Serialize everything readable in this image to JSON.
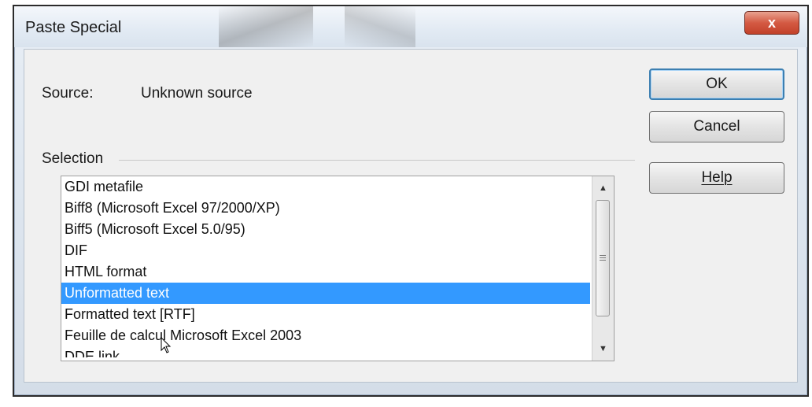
{
  "dialog": {
    "title": "Paste Special",
    "close_label": "x"
  },
  "source": {
    "label": "Source:",
    "value": "Unknown source"
  },
  "selection": {
    "label": "Selection",
    "items": [
      "GDI metafile",
      "Biff8 (Microsoft Excel 97/2000/XP)",
      "Biff5 (Microsoft Excel 5.0/95)",
      "DIF",
      "HTML format",
      "Unformatted text",
      "Formatted text [RTF]",
      "Feuille de calcul Microsoft Excel 2003",
      "DDE link"
    ],
    "selected_item": "Unformatted text"
  },
  "buttons": {
    "ok": "OK",
    "cancel": "Cancel",
    "help": "Help"
  },
  "scrollbar": {
    "up_icon": "arrow-up-icon",
    "down_icon": "arrow-down-icon"
  },
  "colors": {
    "selection_highlight": "#3399ff",
    "close_button": "#c9452f"
  }
}
